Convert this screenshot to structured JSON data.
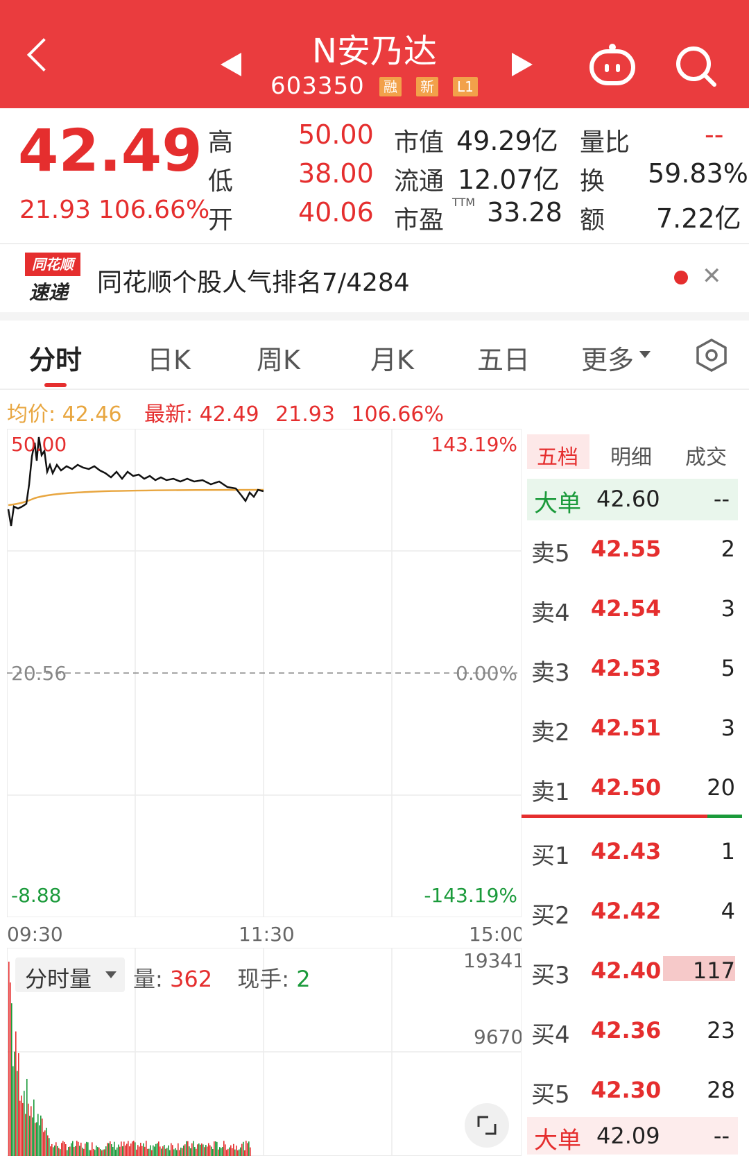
{
  "header": {
    "title": "N安乃达",
    "code": "603350",
    "tags": [
      "融",
      "新",
      "L1"
    ]
  },
  "quote": {
    "price": "42.49",
    "change": "21.93",
    "change_pct": "106.66%",
    "high_label": "高",
    "high": "50.00",
    "low_label": "低",
    "low": "38.00",
    "open_label": "开",
    "open": "40.06",
    "mktcap_label": "市值",
    "mktcap": "49.29亿",
    "float_label": "流通",
    "float": "12.07亿",
    "pe_label": "市盈",
    "pe_sup": "TTM",
    "pe": "33.28",
    "vol_ratio_label": "量比",
    "vol_ratio": "--",
    "turnover_label": "换",
    "turnover": "59.83%",
    "amount_label": "额",
    "amount": "7.22亿"
  },
  "banner": {
    "logo_top": "同花顺",
    "logo_bottom": "速递",
    "text": "同花顺个股人气排名7/4284"
  },
  "tabs": [
    {
      "label": "分时"
    },
    {
      "label": "日K"
    },
    {
      "label": "周K"
    },
    {
      "label": "月K"
    },
    {
      "label": "五日"
    },
    {
      "label": "更多"
    }
  ],
  "info_line": {
    "avg_label": "均价:",
    "avg": "42.46",
    "latest_label": "最新:",
    "latest": "42.49",
    "change": "21.93",
    "change_pct": "106.66%"
  },
  "chart": {
    "y_top": "50.00",
    "y_mid": "20.56",
    "y_bot": "-8.88",
    "pct_top": "143.19%",
    "pct_mid": "0.00%",
    "pct_bot": "-143.19%",
    "x_start": "09:30",
    "x_mid": "11:30",
    "x_end": "15:00"
  },
  "volume_panel": {
    "dropdown": "分时量",
    "vol_label": "量:",
    "vol": "362",
    "hand_label": "现手:",
    "hand": "2",
    "scale_top": "19341",
    "scale_mid": "9670"
  },
  "orderbook": {
    "tabs": [
      "五档",
      "明细",
      "成交"
    ],
    "big_sell": {
      "label": "大单",
      "price": "42.60",
      "vol": "--"
    },
    "sells": [
      {
        "label": "卖5",
        "price": "42.55",
        "vol": "2"
      },
      {
        "label": "卖4",
        "price": "42.54",
        "vol": "3"
      },
      {
        "label": "卖3",
        "price": "42.53",
        "vol": "5"
      },
      {
        "label": "卖2",
        "price": "42.51",
        "vol": "3"
      },
      {
        "label": "卖1",
        "price": "42.50",
        "vol": "20"
      }
    ],
    "buys": [
      {
        "label": "买1",
        "price": "42.43",
        "vol": "1"
      },
      {
        "label": "买2",
        "price": "42.42",
        "vol": "4"
      },
      {
        "label": "买3",
        "price": "42.40",
        "vol": "117"
      },
      {
        "label": "买4",
        "price": "42.36",
        "vol": "23"
      },
      {
        "label": "买5",
        "price": "42.30",
        "vol": "28"
      }
    ],
    "big_buy": {
      "label": "大单",
      "price": "42.09",
      "vol": "--"
    }
  },
  "colors": {
    "brand": "#ea3c3e",
    "up": "#e52e2e",
    "down": "#1a9a3a",
    "avg": "#e8a640"
  }
}
